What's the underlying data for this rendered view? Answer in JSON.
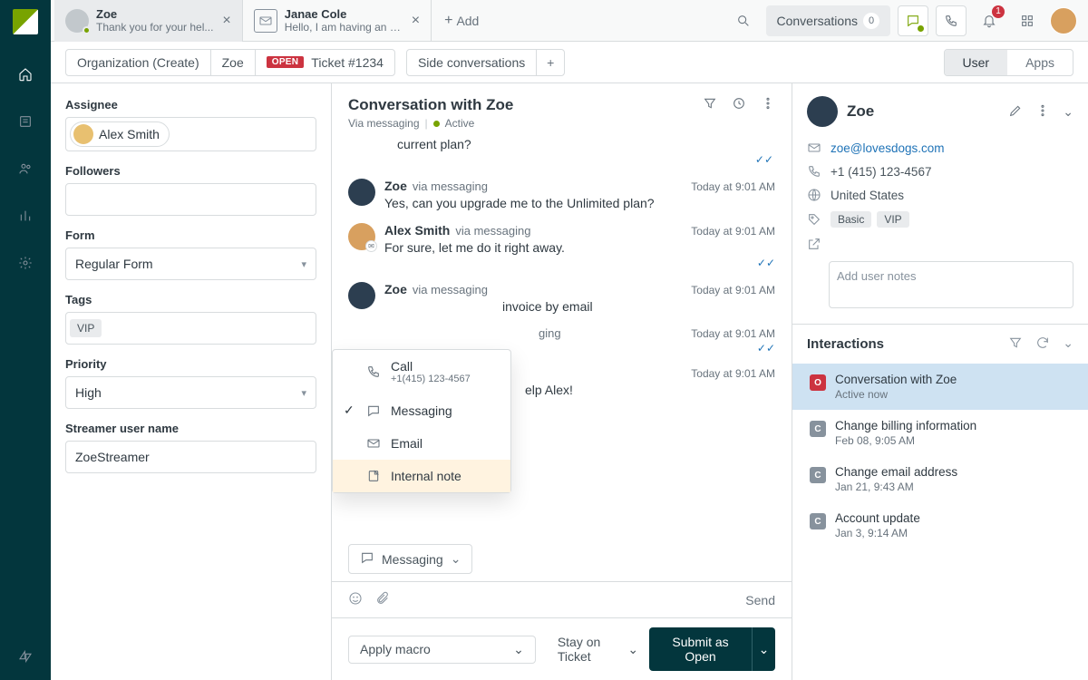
{
  "tabs": [
    {
      "title": "Zoe",
      "subtitle": "Thank you for your hel...",
      "active": true,
      "avatar": true
    },
    {
      "title": "Janae Cole",
      "subtitle": "Hello, I am having an is...",
      "active": false,
      "avatar": false
    }
  ],
  "addTabLabel": "Add",
  "topbar": {
    "conversationsLabel": "Conversations",
    "conversationsCount": "0",
    "notificationCount": "1"
  },
  "breadcrumb": {
    "org": "Organization (Create)",
    "user": "Zoe",
    "ticketStatus": "OPEN",
    "ticketLabel": "Ticket #1234",
    "sideConversations": "Side conversations",
    "toggleUser": "User",
    "toggleApps": "Apps"
  },
  "form": {
    "assigneeLabel": "Assignee",
    "assigneeValue": "Alex Smith",
    "followersLabel": "Followers",
    "formLabel": "Form",
    "formValue": "Regular Form",
    "tagsLabel": "Tags",
    "tagsValues": [
      "VIP"
    ],
    "priorityLabel": "Priority",
    "priorityValue": "High",
    "streamerLabel": "Streamer user name",
    "streamerValue": "ZoeStreamer"
  },
  "conversation": {
    "title": "Conversation with Zoe",
    "viaLabel": "Via messaging",
    "statusLabel": "Active",
    "fragment": "current plan?",
    "messages": [
      {
        "name": "Zoe",
        "via": "via messaging",
        "time": "Today at 9:01 AM",
        "body": "Yes, can you upgrade me to the Unlimited plan?",
        "avatar": "zoe",
        "receipt": false
      },
      {
        "name": "Alex Smith",
        "via": "via messaging",
        "time": "Today at 9:01 AM",
        "body": "For sure, let me do it right away.",
        "avatar": "alex",
        "receipt": true
      },
      {
        "name": "Zoe",
        "via": "via messaging",
        "time": "Today at 9:01 AM",
        "body": "invoice by email",
        "avatar": "zoe",
        "receipt": false
      },
      {
        "name": "",
        "via": "ging",
        "time": "Today at 9:01 AM",
        "body": "",
        "avatar": "",
        "receipt": true
      },
      {
        "name": "",
        "via": "",
        "time": "Today at 9:01 AM",
        "body": "elp Alex!",
        "avatar": "",
        "receipt": false
      }
    ],
    "channelPopup": {
      "callLabel": "Call",
      "callSub": "+1(415) 123-4567",
      "messagingLabel": "Messaging",
      "emailLabel": "Email",
      "internalNoteLabel": "Internal note",
      "selected": "Messaging"
    },
    "channelPill": "Messaging",
    "sendLabel": "Send"
  },
  "footer": {
    "macroLabel": "Apply macro",
    "stayOnLabel": "Stay on Ticket",
    "submitLabel": "Submit as Open"
  },
  "userPanel": {
    "name": "Zoe",
    "email": "zoe@lovesdogs.com",
    "phone": "+1 (415) 123-4567",
    "location": "United States",
    "tags": [
      "Basic",
      "VIP"
    ],
    "notesPlaceholder": "Add user notes",
    "interactionsHeader": "Interactions",
    "interactions": [
      {
        "badge": "O",
        "kind": "o",
        "title": "Conversation with Zoe",
        "sub": "Active now",
        "active": true
      },
      {
        "badge": "C",
        "kind": "c",
        "title": "Change billing information",
        "sub": "Feb 08, 9:05 AM",
        "active": false
      },
      {
        "badge": "C",
        "kind": "c",
        "title": "Change email address",
        "sub": "Jan 21, 9:43 AM",
        "active": false
      },
      {
        "badge": "C",
        "kind": "c",
        "title": "Account update",
        "sub": "Jan 3, 9:14 AM",
        "active": false
      }
    ]
  }
}
